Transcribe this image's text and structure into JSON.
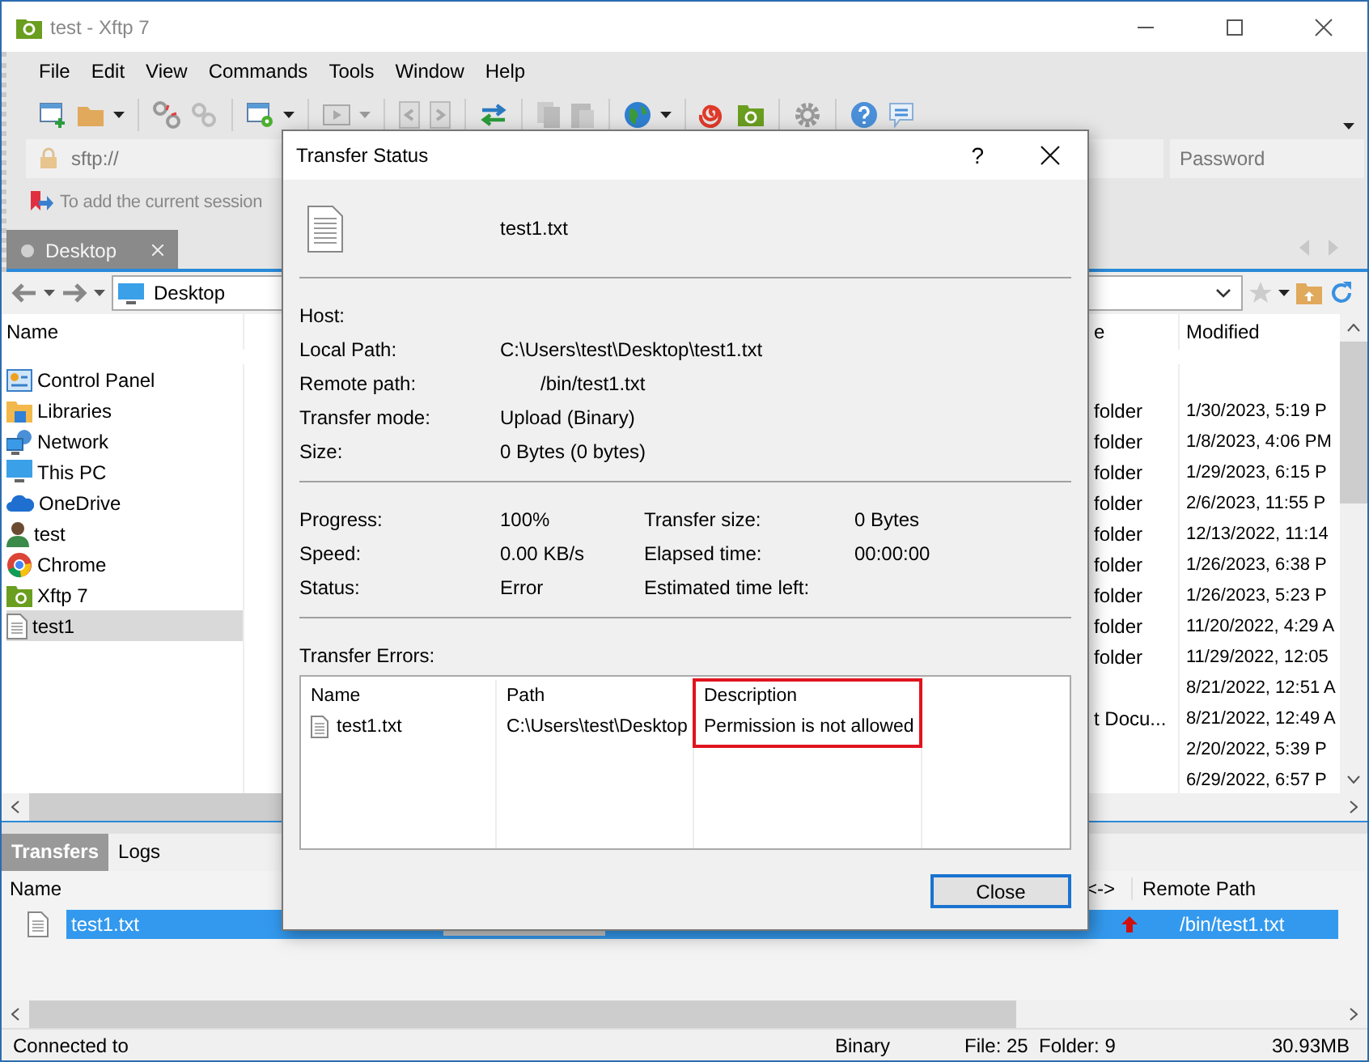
{
  "window": {
    "title": "test - Xftp 7"
  },
  "menu": [
    "File",
    "Edit",
    "View",
    "Commands",
    "Tools",
    "Window",
    "Help"
  ],
  "address_bar": {
    "placeholder": "sftp://",
    "password_placeholder": "Password"
  },
  "links_bar": {
    "hint": "To add the current session"
  },
  "session_tabs": [
    {
      "label": "Desktop",
      "selected": true
    }
  ],
  "path_bar": {
    "path": "Desktop"
  },
  "file_list": {
    "columns": [
      "Name",
      "e",
      "Modified"
    ],
    "rows": [
      {
        "name": "Control Panel",
        "kind": "control",
        "selected": false
      },
      {
        "name": "Libraries",
        "kind": "library",
        "type": "folder",
        "modified": "1/30/2023, 5:19 P",
        "selected": false
      },
      {
        "name": "Network",
        "kind": "network",
        "type": "folder",
        "modified": "1/8/2023, 4:06 PM",
        "selected": false
      },
      {
        "name": "This PC",
        "kind": "pc",
        "type": "folder",
        "modified": "1/29/2023, 6:15 P",
        "selected": false
      },
      {
        "name": "OneDrive",
        "kind": "cloud",
        "type": "folder",
        "modified": "2/6/2023, 11:55 P",
        "selected": false
      },
      {
        "name": "test",
        "kind": "user",
        "type": "folder",
        "modified": "12/13/2022, 11:14",
        "selected": false
      },
      {
        "name": "Chrome",
        "kind": "browser",
        "type": "folder",
        "modified": "1/26/2023, 6:38 P",
        "selected": false
      },
      {
        "name": "Xftp 7",
        "kind": "app",
        "type": "folder",
        "modified": "1/26/2023, 5:23 P",
        "selected": false
      },
      {
        "name": "test1",
        "kind": "file",
        "type": "folder",
        "modified": "11/20/2022, 4:29 A",
        "selected": true
      },
      {
        "type": "folder",
        "modified": "11/29/2022, 12:05"
      },
      {
        "modified": "8/21/2022, 12:51 A"
      },
      {
        "type": "t Docu...",
        "modified": "8/21/2022, 12:49 A"
      },
      {
        "modified": "2/20/2022, 5:39 P"
      },
      {
        "modified": "6/29/2022, 6:57 P"
      }
    ]
  },
  "bottom_tabs": [
    {
      "label": "Transfers",
      "selected": true
    },
    {
      "label": "Logs",
      "selected": false
    }
  ],
  "transfers": {
    "columns": [
      "Name",
      "<->",
      "Remote Path"
    ],
    "rows": [
      {
        "name": "test1.txt",
        "kind": "upload",
        "remote": "/bin/test1.txt",
        "selected": true
      }
    ]
  },
  "status_bar": {
    "connection": "Connected to",
    "mode": "Binary",
    "counts": "File: 25  Folder: 9",
    "size": "30.93MB"
  },
  "dialog": {
    "title": "Transfer Status",
    "help": "?",
    "file": "test1.txt",
    "details": [
      {
        "label": "Host:"
      },
      {
        "label": "Local Path:",
        "value": "C:\\Users\\test\\Desktop\\test1.txt"
      },
      {
        "label": "Remote path:",
        "value": "/bin/test1.txt"
      },
      {
        "label": "Transfer mode:",
        "value": "Upload (Binary)"
      },
      {
        "label": "Size:",
        "value": "0 Bytes (0 bytes)"
      }
    ],
    "stats_left": [
      {
        "label": "Progress:",
        "value": "100%"
      },
      {
        "label": "Speed:",
        "value": "0.00 KB/s"
      },
      {
        "label": "Status:",
        "value": "Error"
      }
    ],
    "stats_right": [
      {
        "label": "Transfer size:",
        "value": "0 Bytes"
      },
      {
        "label": "Elapsed time:",
        "value": "00:00:00"
      },
      {
        "label": "Estimated time left:"
      }
    ],
    "errors_label": "Transfer Errors:",
    "errors": {
      "columns": [
        {
          "label": "Name",
          "highlighted": false
        },
        {
          "label": "Path",
          "highlighted": false
        },
        {
          "label": "Description",
          "highlighted": true
        }
      ],
      "rows": [
        [
          "test1.txt",
          "C:\\Users\\test\\Desktop",
          "Permission is not allowed"
        ]
      ]
    },
    "close": "Close"
  }
}
